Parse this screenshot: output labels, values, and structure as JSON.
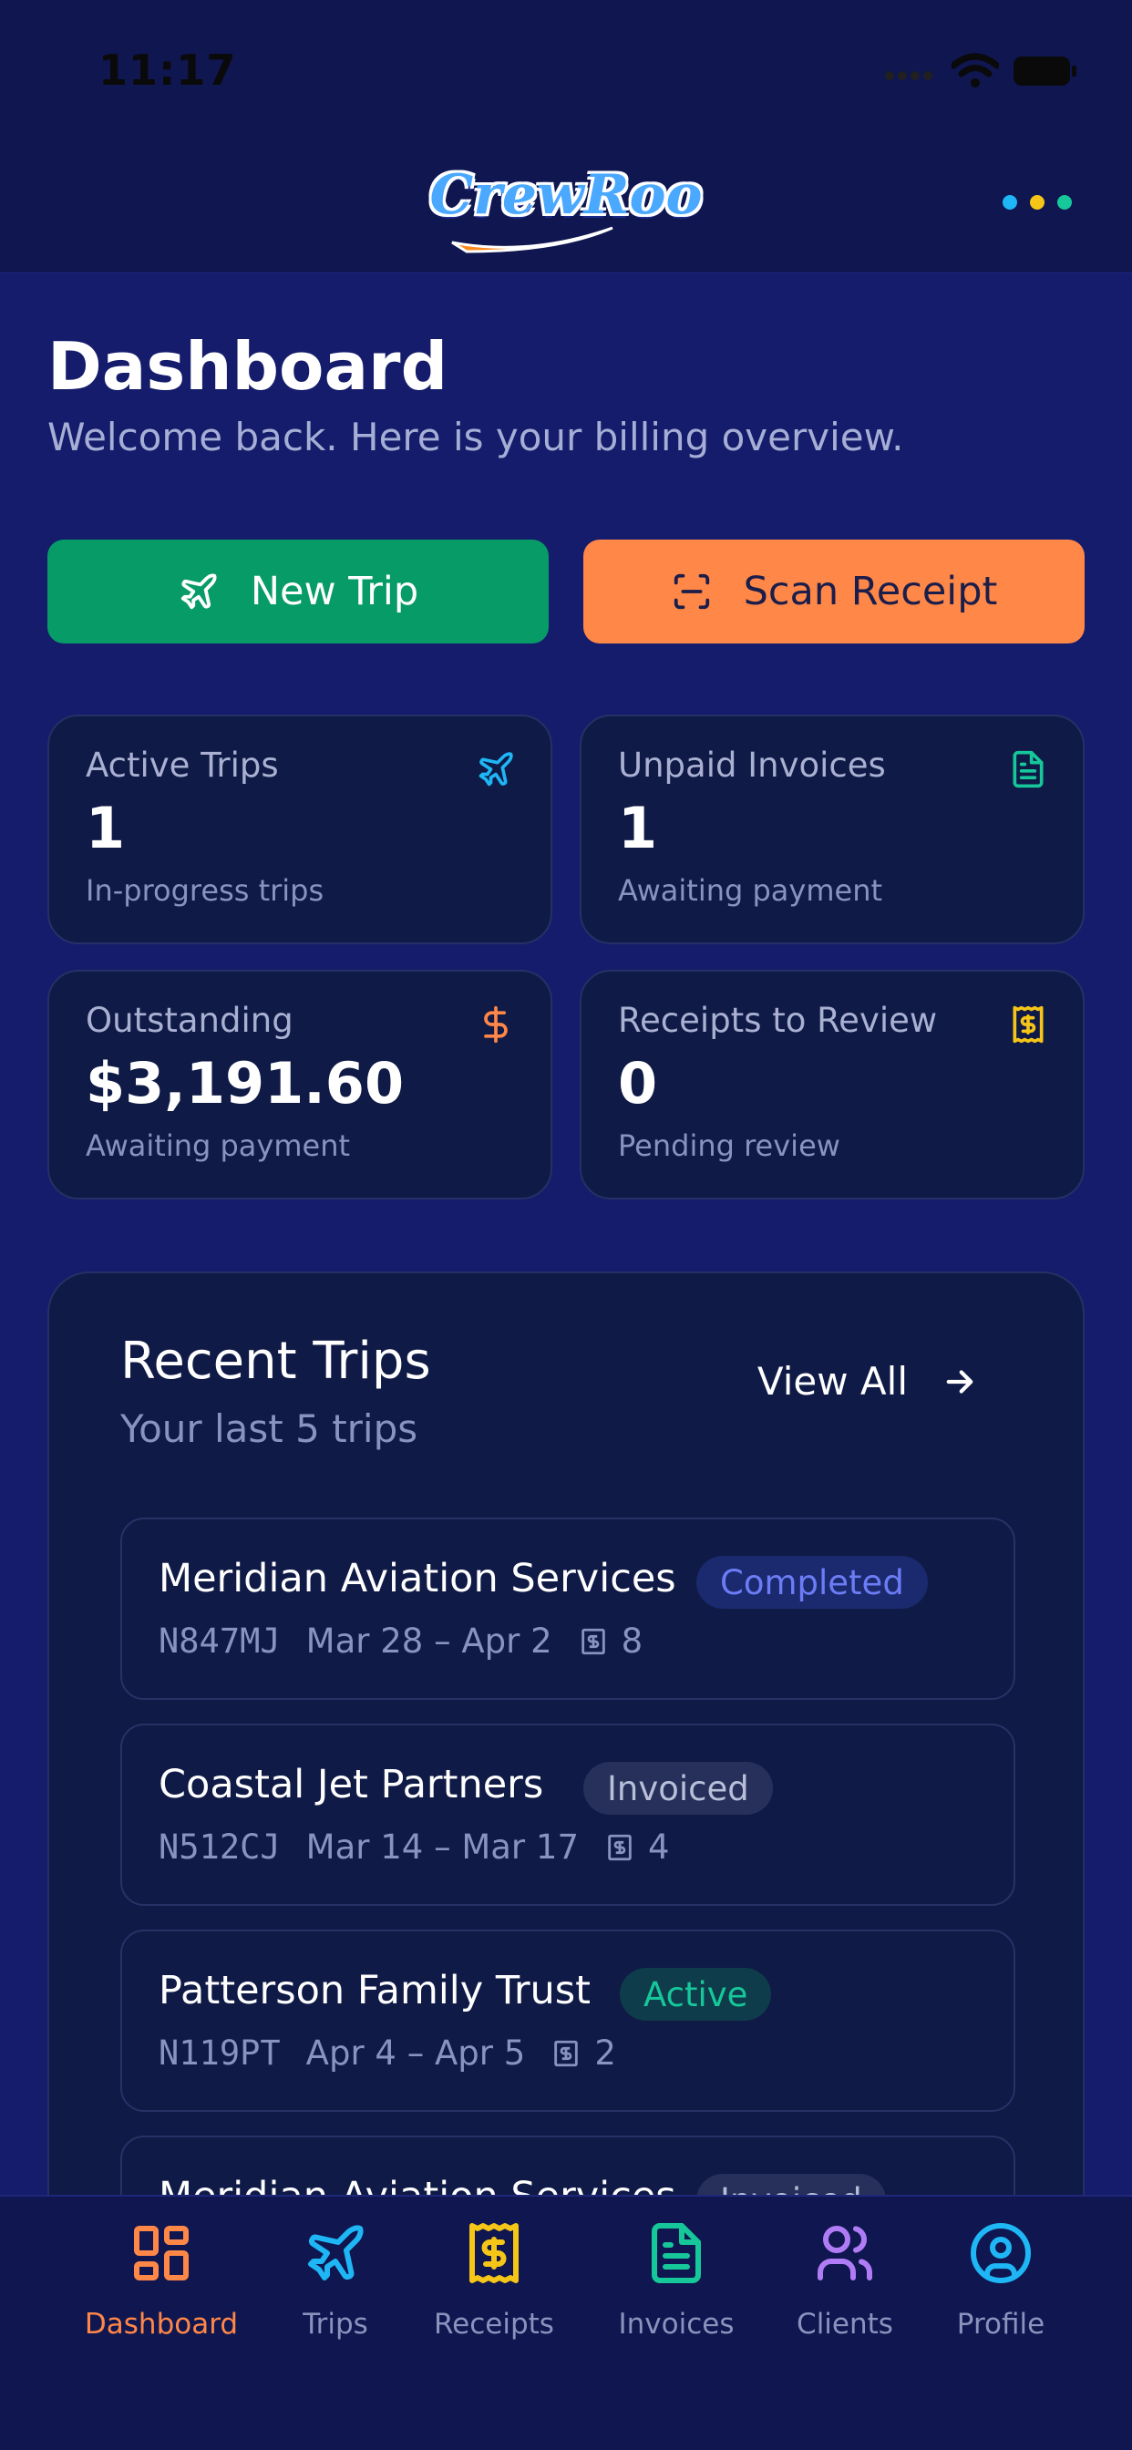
{
  "status_bar": {
    "time": "11:17"
  },
  "header": {
    "logo_text": "CrewRoo"
  },
  "page": {
    "title": "Dashboard",
    "subtitle": "Welcome back. Here is your billing overview."
  },
  "actions": {
    "new_trip": "New Trip",
    "scan_receipt": "Scan Receipt"
  },
  "stats": [
    {
      "label": "Active Trips",
      "value": "1",
      "sub": "In-progress trips",
      "icon": "plane-icon",
      "color": "#1fb6f5"
    },
    {
      "label": "Unpaid Invoices",
      "value": "1",
      "sub": "Awaiting payment",
      "icon": "invoice-icon",
      "color": "#16c79a"
    },
    {
      "label": "Outstanding",
      "value": "$3,191.60",
      "sub": "Awaiting payment",
      "icon": "dollar-icon",
      "color": "#ff8748"
    },
    {
      "label": "Receipts to Review",
      "value": "0",
      "sub": "Pending review",
      "icon": "receipt-icon",
      "color": "#f5c518"
    }
  ],
  "recent_trips": {
    "title": "Recent Trips",
    "subtitle": "Your last 5 trips",
    "view_all": "View All",
    "items": [
      {
        "client": "Meridian Aviation Services",
        "status": "Completed",
        "tail": "N847MJ",
        "dates": "Mar 28 – Apr 2",
        "receipts": "8"
      },
      {
        "client": "Coastal Jet Partners",
        "status": "Invoiced",
        "tail": "N512CJ",
        "dates": "Mar 14 – Mar 17",
        "receipts": "4"
      },
      {
        "client": "Patterson Family Trust",
        "status": "Active",
        "tail": "N119PT",
        "dates": "Apr 4 – Apr 5",
        "receipts": "2"
      },
      {
        "client": "Meridian Aviation Services",
        "status": "Invoiced"
      }
    ]
  },
  "nav": [
    {
      "label": "Dashboard",
      "icon": "dashboard-icon",
      "color": "#ff8748",
      "active": true
    },
    {
      "label": "Trips",
      "icon": "plane-icon",
      "color": "#1fb6f5"
    },
    {
      "label": "Receipts",
      "icon": "receipt-icon",
      "color": "#f5c518"
    },
    {
      "label": "Invoices",
      "icon": "invoice-icon",
      "color": "#16c79a"
    },
    {
      "label": "Clients",
      "icon": "users-icon",
      "color": "#b07cf5"
    },
    {
      "label": "Profile",
      "icon": "profile-icon",
      "color": "#1fb6f5"
    }
  ],
  "colors": {
    "background": "#151c6b",
    "card": "#0f1a46",
    "new_trip_button": "#079b68",
    "scan_button": "#ff8748",
    "badge_completed": "#6c7cf5",
    "badge_invoiced": "#b8bfd9",
    "badge_active": "#16c79a"
  }
}
